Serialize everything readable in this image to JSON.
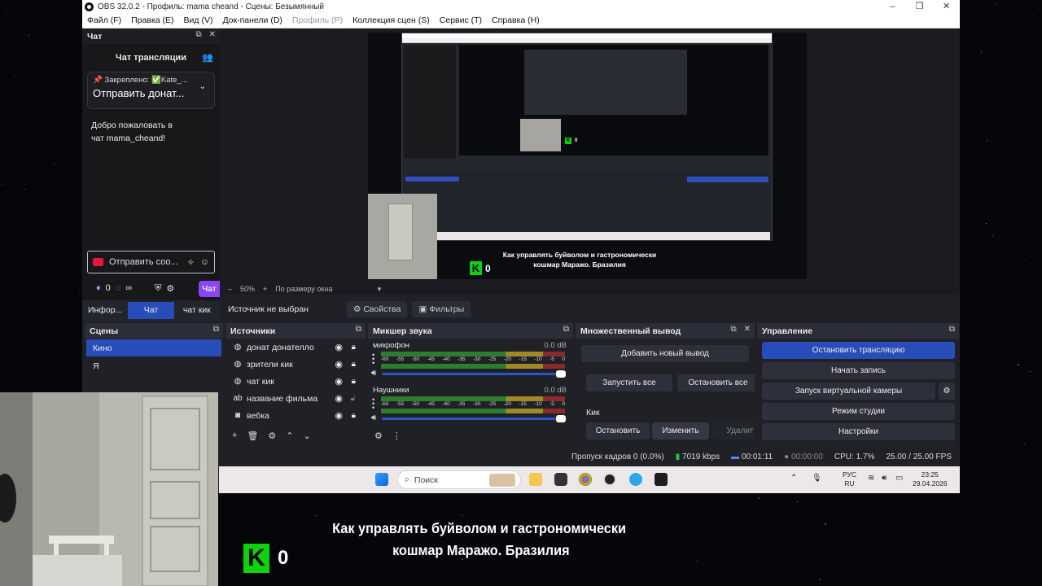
{
  "window": {
    "title": "OBS 32.0.2 - Профиль: mama cheand - Сцены: Безымянный",
    "controls": [
      "–",
      "❐",
      "✕"
    ]
  },
  "menu": [
    {
      "label": "Файл (F)",
      "enabled": true
    },
    {
      "label": "Правка (E)",
      "enabled": true
    },
    {
      "label": "Вид (V)",
      "enabled": true
    },
    {
      "label": "Док-панели (D)",
      "enabled": true
    },
    {
      "label": "Профиль (P)",
      "enabled": false
    },
    {
      "label": "Коллекция сцен (S)",
      "enabled": true
    },
    {
      "label": "Сервис (T)",
      "enabled": true
    },
    {
      "label": "Справка (H)",
      "enabled": true
    }
  ],
  "chat": {
    "dock_title": "Чат",
    "header": "Чат трансляции",
    "pinned_label": "Закреплено:",
    "pinned_user": "Kate_...",
    "pinned_text": "Отправить донат...",
    "welcome": "Добро пожаловать в чат mama_cheand!",
    "input_placeholder": "Отправить соо...",
    "points": "0",
    "infinity": "∞",
    "send_label": "Чат"
  },
  "dock_tabs": [
    {
      "label": "Инфор...",
      "active": false
    },
    {
      "label": "Чат",
      "active": true
    },
    {
      "label": "чат кик",
      "active": false
    }
  ],
  "preview": {
    "zoom": "50%",
    "fit": "По размеру окна",
    "overlay_line1": "Как управлять буйволом и гастрономически",
    "overlay_line2": "кошмар Маражо. Бразилия",
    "kick_count": "0"
  },
  "source_toolbar": {
    "no_source": "Источник не выбран",
    "properties": "Свойства",
    "filters": "Фильтры"
  },
  "scenes": {
    "title": "Сцены",
    "items": [
      {
        "name": "Кино",
        "selected": true
      },
      {
        "name": "Я",
        "selected": false
      }
    ]
  },
  "sources": {
    "title": "Источники",
    "items": [
      {
        "name": "донат донателло",
        "icon": "globe-icon",
        "locked": true
      },
      {
        "name": "зрители кик",
        "icon": "globe-icon",
        "locked": true
      },
      {
        "name": "чат кик",
        "icon": "globe-icon",
        "locked": true
      },
      {
        "name": "название фильма",
        "icon": "text-icon",
        "locked": false
      },
      {
        "name": "вебка",
        "icon": "camera-icon",
        "locked": true
      }
    ]
  },
  "mixer": {
    "title": "Микшер звука",
    "channels": [
      {
        "name": "микрофон",
        "db": "0.0 dB",
        "volume": 1.0
      },
      {
        "name": "Наушники",
        "db": "0.0 dB",
        "volume": 1.0
      }
    ],
    "scale": [
      "-60",
      "-55",
      "-50",
      "-45",
      "-40",
      "-35",
      "-30",
      "-25",
      "-20",
      "-15",
      "-10",
      "-5",
      "0"
    ]
  },
  "multi": {
    "title": "Множественный вывод",
    "add": "Добавить новый вывод",
    "start_all": "Запустить все",
    "stop_all": "Остановить все",
    "target": "Кик",
    "stop": "Остановить",
    "edit": "Изменить",
    "delete": "Удалит"
  },
  "controls": {
    "title": "Управление",
    "stop_stream": "Остановить трансляцию",
    "record": "Начать запись",
    "virtual_cam": "Запуск виртуальной камеры",
    "studio": "Режим студии",
    "settings": "Настройки"
  },
  "status": {
    "dropped": "Пропуск кадров 0 (0.0%)",
    "bitrate": "7019 kbps",
    "stream_time": "00:01:11",
    "rec_time": "00:00:00",
    "cpu": "CPU: 1.7%",
    "fps": "25.00 / 25.00 FPS"
  },
  "taskbar": {
    "search": "Поиск",
    "lang1": "РУС",
    "lang2": "RU",
    "time": "23:25",
    "date": "29.04.2026"
  },
  "subtitle": {
    "line1": "Как управлять буйволом и гастрономически",
    "line2": " кошмар Маражо. Бразилия",
    "kick_count": "0"
  },
  "colors": {
    "accent": "#284cb8",
    "kick_green": "#0fd20f",
    "twitch_purple": "#8b44f7",
    "bg_dark": "#1f2127"
  }
}
